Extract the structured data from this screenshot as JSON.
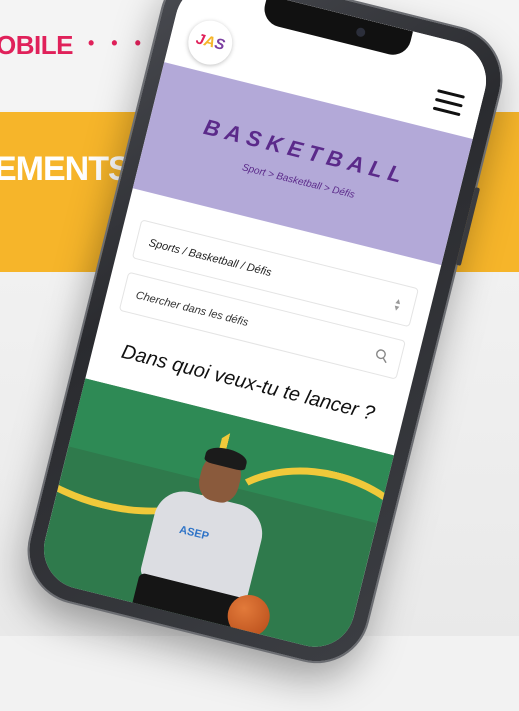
{
  "background": {
    "mobile_text": "OBILE",
    "dots": "• • • • •",
    "events_text": "EMENTS",
    "accent_yellow": "#f6b52a",
    "accent_pink": "#e0215a"
  },
  "app": {
    "logo": {
      "j": "J",
      "a": "A",
      "s": "S"
    },
    "menu_icon": "hamburger-icon"
  },
  "hero": {
    "title": "BASKETBALL",
    "breadcrumb": "Sport > Basketball > Défis",
    "color": "#b3a9d8"
  },
  "filters": {
    "category_select": "Sports / Basketball / Défis",
    "search_placeholder": "Chercher dans les défis"
  },
  "section": {
    "heading": "Dans quoi veux-tu te lancer ?"
  },
  "photo": {
    "shirt_text": "ASEP"
  }
}
